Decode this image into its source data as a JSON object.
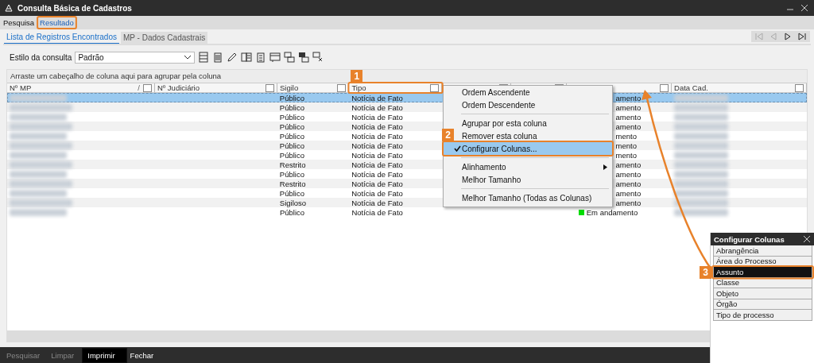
{
  "window": {
    "title": "Consulta Básica de Cadastros"
  },
  "menu": [
    {
      "label": "Pesquisa",
      "selected": false
    },
    {
      "label": "Resultado",
      "selected": true
    }
  ],
  "tabs": [
    {
      "label": "Lista de Registros Encontrados",
      "selected": true
    },
    {
      "label": "MP - Dados Cadastrais",
      "selected": false
    }
  ],
  "toolbar": {
    "label": "Estilo da consulta",
    "style_value": "Padrão"
  },
  "group_hint": "Arraste um cabeçalho de coluna aqui para agrupar pela coluna",
  "table": {
    "columns": [
      {
        "label": "Nº MP",
        "sort_mark": "/"
      },
      {
        "label": "Nº Judiciário"
      },
      {
        "label": "Sigilo"
      },
      {
        "label": "Tipo"
      },
      {},
      {},
      {},
      {
        "label": "Data Cad."
      }
    ],
    "rows": [
      {
        "selected": true,
        "sigilo": "Público",
        "tipo": "Notícia de Fato",
        "situacao": "amento"
      },
      {
        "selected": false,
        "sigilo": "Público",
        "tipo": "Notícia de Fato",
        "situacao": "amento"
      },
      {
        "selected": false,
        "sigilo": "Público",
        "tipo": "Notícia de Fato",
        "situacao": "amento"
      },
      {
        "selected": false,
        "sigilo": "Público",
        "tipo": "Notícia de Fato",
        "situacao": "amento"
      },
      {
        "selected": false,
        "sigilo": "Público",
        "tipo": "Notícia de Fato",
        "situacao": "mento"
      },
      {
        "selected": false,
        "sigilo": "Público",
        "tipo": "Notícia de Fato",
        "situacao": "mento"
      },
      {
        "selected": false,
        "sigilo": "Público",
        "tipo": "Notícia de Fato",
        "situacao": "mento"
      },
      {
        "selected": false,
        "sigilo": "Restrito",
        "tipo": "Notícia de Fato",
        "situacao": "amento"
      },
      {
        "selected": false,
        "sigilo": "Público",
        "tipo": "Notícia de Fato",
        "situacao": "amento"
      },
      {
        "selected": false,
        "sigilo": "Restrito",
        "tipo": "Notícia de Fato",
        "situacao": "amento"
      },
      {
        "selected": false,
        "sigilo": "Público",
        "tipo": "Notícia de Fato",
        "situacao": "amento"
      },
      {
        "selected": false,
        "sigilo": "Sigiloso",
        "tipo": "Notícia de Fato",
        "situacao": "amento"
      },
      {
        "selected": false,
        "sigilo": "Público",
        "tipo": "Notícia de Fato",
        "situacao": "Em andamento",
        "color": "#00dd00"
      }
    ]
  },
  "context_menu": [
    {
      "kind": "item",
      "label": "Ordem Ascendente",
      "checked": false,
      "selected": false
    },
    {
      "kind": "item",
      "label": "Ordem Descendente",
      "checked": false,
      "selected": false
    },
    {
      "kind": "separator"
    },
    {
      "kind": "item",
      "label": "Agrupar por esta coluna",
      "checked": false,
      "selected": false
    },
    {
      "kind": "item",
      "label": "Remover esta coluna",
      "checked": false,
      "selected": false
    },
    {
      "kind": "item",
      "label": "Configurar Colunas...",
      "checked": true,
      "selected": true
    },
    {
      "kind": "separator"
    },
    {
      "kind": "item",
      "label": "Alinhamento",
      "checked": false,
      "selected": false,
      "submenu": true
    },
    {
      "kind": "item",
      "label": "Melhor Tamanho",
      "checked": false,
      "selected": false
    },
    {
      "kind": "separator"
    },
    {
      "kind": "item",
      "label": "Melhor Tamanho (Todas as Colunas)",
      "checked": false,
      "selected": false
    }
  ],
  "column_panel": {
    "title": "Configurar Colunas",
    "items": [
      {
        "label": "Abrangência",
        "selected": false
      },
      {
        "label": "Área do Processo",
        "selected": false
      },
      {
        "label": "Assunto",
        "selected": true
      },
      {
        "label": "Classe",
        "selected": false
      },
      {
        "label": "Objeto",
        "selected": false
      },
      {
        "label": "Órgão",
        "selected": false
      },
      {
        "label": "Tipo de processo",
        "selected": false
      }
    ]
  },
  "bottom_buttons": [
    {
      "label": "Pesquisar",
      "disabled": true,
      "selected": false
    },
    {
      "label": "Limpar",
      "disabled": true,
      "selected": false
    },
    {
      "label": "Imprimir",
      "disabled": false,
      "selected": true
    },
    {
      "label": "Fechar",
      "disabled": false,
      "selected": false
    }
  ],
  "annotations": [
    "1",
    "2",
    "3"
  ]
}
